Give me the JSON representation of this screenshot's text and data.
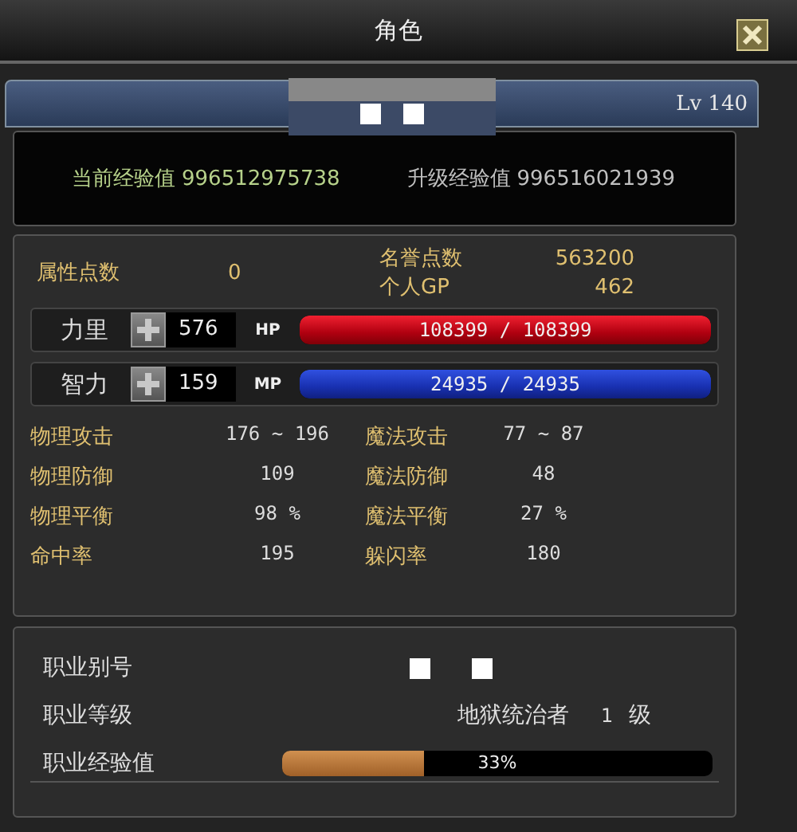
{
  "window": {
    "title": "角色"
  },
  "character": {
    "level": "Lv 140"
  },
  "experience": [
    {
      "label": "当前经验值",
      "value": "996512975738"
    },
    {
      "label": "升级经验值",
      "value": "996516021939"
    }
  ],
  "points": [
    {
      "label": "属性点数",
      "value": "0"
    },
    {
      "label": "名誉点数",
      "value": "563200"
    },
    {
      "label": "个人GP",
      "value": "462"
    }
  ],
  "attributes": [
    {
      "label": "力里",
      "value": "576",
      "bar_label": "HP",
      "bar_text": "108399 / 108399",
      "level": 1,
      "kind": "hp"
    },
    {
      "label": "智力",
      "value": "159",
      "bar_label": "MP",
      "bar_text": "24935 / 24935",
      "level": 1,
      "kind": "mp"
    }
  ],
  "stats": [
    {
      "label": "物理攻击",
      "value": "176 ~ 196"
    },
    {
      "label": "魔法攻击",
      "value": "77 ~ 87"
    },
    {
      "label": "物理防御",
      "value": "109"
    },
    {
      "label": "魔法防御",
      "value": "48"
    },
    {
      "label": "物理平衡",
      "value": "98 %"
    },
    {
      "label": "魔法平衡",
      "value": "27 %"
    },
    {
      "label": "命中率",
      "value": "195"
    },
    {
      "label": "躲闪率",
      "value": "180"
    }
  ],
  "job": {
    "alias_label": "职业别号",
    "level_label": "职业等级",
    "job_name": "地狱统治者",
    "job_level": "1",
    "job_level_unit": "级",
    "exp_label": "职业经验值",
    "level": 0.33,
    "exp_text": "33%"
  }
}
